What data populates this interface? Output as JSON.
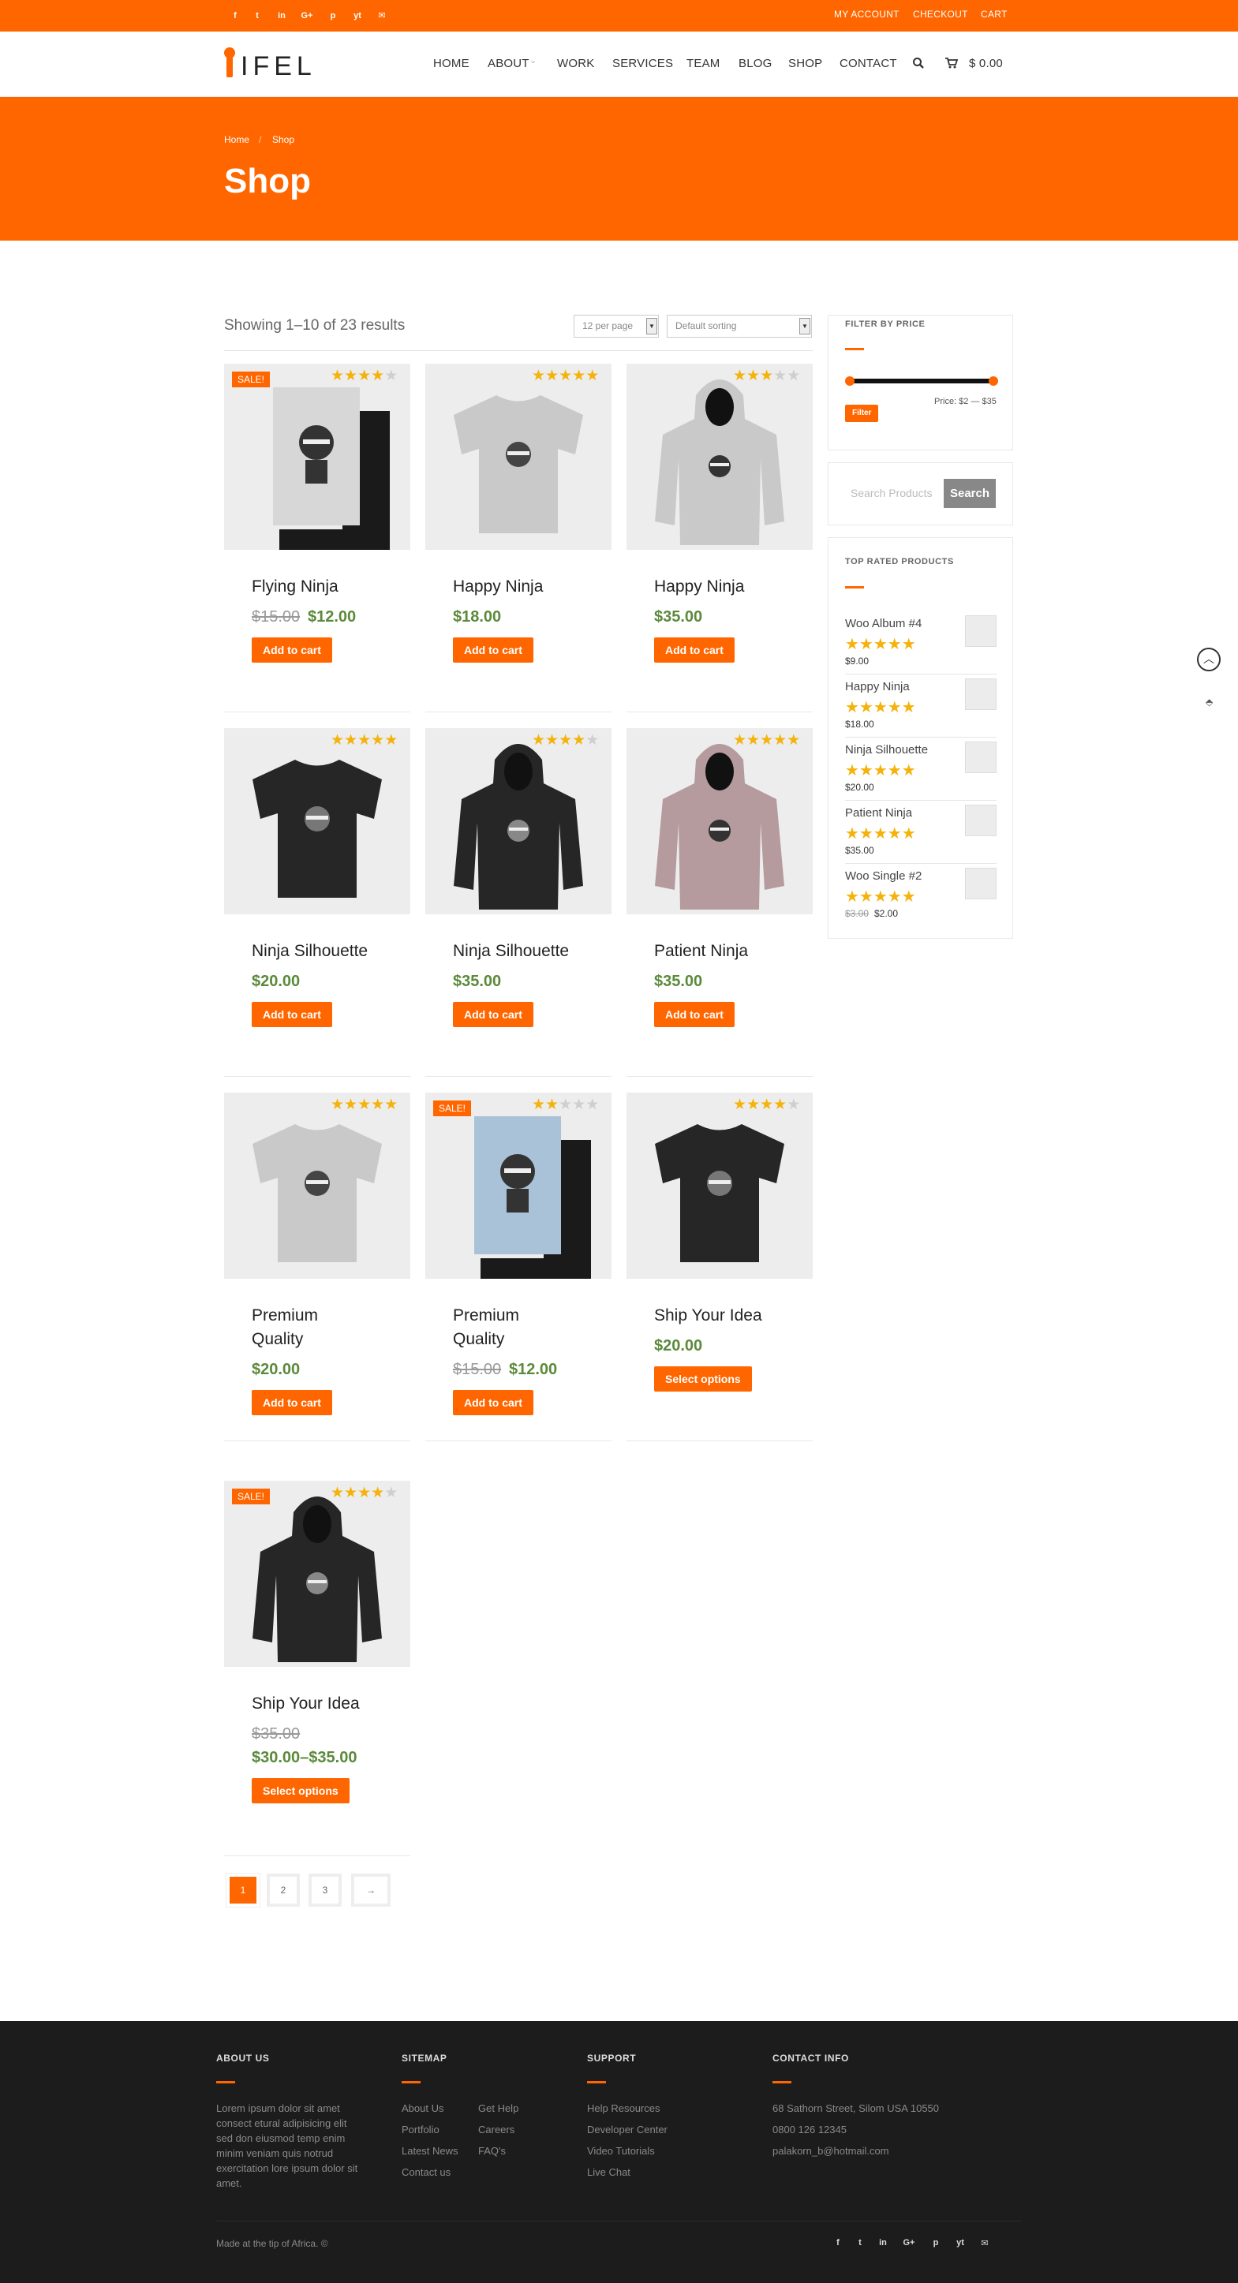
{
  "topbar": {
    "social": [
      "f",
      "t",
      "in",
      "G+",
      "p",
      "yt",
      "✉"
    ],
    "links": [
      "MY ACCOUNT",
      "CHECKOUT",
      "CART"
    ]
  },
  "header": {
    "logo": "IFEL",
    "nav": [
      "HOME",
      "ABOUT",
      "WORK",
      "SERVICES",
      "TEAM",
      "BLOG",
      "SHOP",
      "CONTACT"
    ],
    "about_caret": "⌄",
    "search_icon": "search-icon",
    "cart_total": "$ 0.00"
  },
  "hero": {
    "breadcrumb": [
      "Home",
      "/",
      "Shop"
    ],
    "title": "Shop"
  },
  "toolbar": {
    "result_count": "Showing 1–10 of 23 results",
    "per_page": "12 per page",
    "sorting": "Default sorting"
  },
  "products": [
    {
      "name": "Flying Ninja",
      "name2": "",
      "old_price": "$15.00",
      "price": "$12.00",
      "button": "Add to cart",
      "sale": "SALE!",
      "rating": 4
    },
    {
      "name": "Happy Ninja",
      "name2": "",
      "old_price": "",
      "price": "$18.00",
      "button": "Add to cart",
      "sale": "",
      "rating": 5
    },
    {
      "name": "Happy Ninja",
      "name2": "",
      "old_price": "",
      "price": "$35.00",
      "button": "Add to cart",
      "sale": "",
      "rating": 3
    },
    {
      "name": "Ninja Silhouette",
      "name2": "",
      "old_price": "",
      "price": "$20.00",
      "button": "Add to cart",
      "sale": "",
      "rating": 5
    },
    {
      "name": "Ninja Silhouette",
      "name2": "",
      "old_price": "",
      "price": "$35.00",
      "button": "Add to cart",
      "sale": "",
      "rating": 4
    },
    {
      "name": "Patient Ninja",
      "name2": "",
      "old_price": "",
      "price": "$35.00",
      "button": "Add to cart",
      "sale": "",
      "rating": 5
    },
    {
      "name": "Premium",
      "name2": "Quality",
      "old_price": "",
      "price": "$20.00",
      "button": "Add to cart",
      "sale": "",
      "rating": 4.5
    },
    {
      "name": "Premium",
      "name2": "Quality",
      "old_price": "$15.00",
      "price": "$12.00",
      "button": "Add to cart",
      "sale": "SALE!",
      "rating": 2
    },
    {
      "name": "Ship Your Idea",
      "name2": "",
      "old_price": "",
      "price": "$20.00",
      "button": "Select options",
      "sale": "",
      "rating": 4
    },
    {
      "name": "Ship Your Idea",
      "name2": "",
      "old_price": "$35.00",
      "price": "$30.00–$35.00",
      "button": "Select options",
      "sale": "SALE!",
      "rating": 4
    }
  ],
  "pagination": [
    "1",
    "2",
    "3",
    "→"
  ],
  "sidebar": {
    "filter": {
      "title": "FILTER BY PRICE",
      "price_label": "Price: $2 — $35",
      "button": "Filter"
    },
    "search": {
      "placeholder": "Search Products",
      "button": "Search"
    },
    "top_rated": {
      "title": "TOP RATED PRODUCTS",
      "items": [
        {
          "name": "Woo Album #4",
          "price": "$9.00",
          "old_price": "",
          "rating": 5
        },
        {
          "name": "Happy Ninja",
          "price": "$18.00",
          "old_price": "",
          "rating": 5
        },
        {
          "name": "Ninja Silhouette",
          "price": "$20.00",
          "old_price": "",
          "rating": 5
        },
        {
          "name": "Patient Ninja",
          "price": "$35.00",
          "old_price": "",
          "rating": 5
        },
        {
          "name": "Woo Single #2",
          "price": "$2.00",
          "old_price": "$3.00",
          "rating": 4.5
        }
      ]
    }
  },
  "footer": {
    "about": {
      "title": "ABOUT US",
      "text": "Lorem ipsum dolor sit amet consect etural adipisicing elit sed don eiusmod temp enim minim veniam quis notrud exercitation lore ipsum dolor sit amet."
    },
    "sitemap": {
      "title": "SITEMAP",
      "col1": [
        "About Us",
        "Portfolio",
        "Latest News",
        "Contact us"
      ],
      "col2": [
        "Get Help",
        "Careers",
        "FAQ's"
      ]
    },
    "support": {
      "title": "SUPPORT",
      "links": [
        "Help Resources",
        "Developer Center",
        "Video Tutorials",
        "Live Chat"
      ]
    },
    "contact": {
      "title": "CONTACT INFO",
      "lines": [
        "68 Sathorn Street, Silom USA 10550",
        "0800 126 12345",
        "palakorn_b@hotmail.com"
      ]
    },
    "copyright": "Made at the tip of Africa. ©",
    "social": [
      "f",
      "t",
      "in",
      "G+",
      "p",
      "yt",
      "✉"
    ]
  },
  "colors": {
    "accent": "#ff6600",
    "price": "#5a8a3a",
    "star": "#f5b20b",
    "footer_bg": "#1c1c1d"
  }
}
